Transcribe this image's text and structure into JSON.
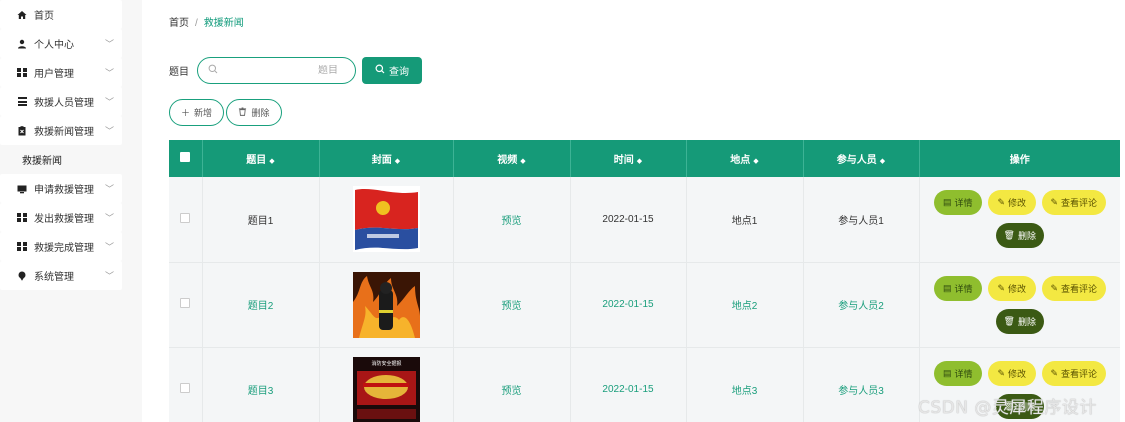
{
  "sidebar": {
    "items": [
      {
        "label": "首页",
        "icon": "home-icon",
        "has_arrow": false
      },
      {
        "label": "个人中心",
        "icon": "person-icon",
        "has_arrow": true
      },
      {
        "label": "用户管理",
        "icon": "grid-icon",
        "has_arrow": true
      },
      {
        "label": "救援人员管理",
        "icon": "list-icon",
        "has_arrow": true
      },
      {
        "label": "救援新闻管理",
        "icon": "clipboard-icon",
        "has_arrow": true
      }
    ],
    "active_sub": "救援新闻",
    "items_after": [
      {
        "label": "申请救援管理",
        "icon": "monitor-icon",
        "has_arrow": true
      },
      {
        "label": "发出救援管理",
        "icon": "grid-icon",
        "has_arrow": true
      },
      {
        "label": "救援完成管理",
        "icon": "grid-icon",
        "has_arrow": true
      },
      {
        "label": "系统管理",
        "icon": "pin-icon",
        "has_arrow": true
      }
    ]
  },
  "breadcrumb": {
    "home": "首页",
    "separator": "/",
    "current": "救援新闻"
  },
  "search": {
    "label": "题目",
    "placeholder": "题目",
    "query_label": "查询"
  },
  "actions": {
    "add_label": "新增",
    "delete_label": "删除"
  },
  "table": {
    "columns": [
      "题目",
      "封面",
      "视频",
      "时间",
      "地点",
      "参与人员",
      "操作"
    ],
    "rows": [
      {
        "title": "题目1",
        "cover": "flag-image",
        "video": "预览",
        "time": "2022-01-15",
        "place": "地点1",
        "people": "参与人员1"
      },
      {
        "title": "题目2",
        "cover": "firefighter-image",
        "video": "预览",
        "time": "2022-01-15",
        "place": "地点2",
        "people": "参与人员2"
      },
      {
        "title": "题目3",
        "cover": "poster-image",
        "video": "预览",
        "time": "2022-01-15",
        "place": "地点3",
        "people": "参与人员3"
      }
    ],
    "op_labels": {
      "detail": "详情",
      "edit": "修改",
      "comment": "查看评论",
      "delete": "删除"
    }
  },
  "poster_text": "消防安全据报",
  "watermark": "CSDN @灵犀程序设计",
  "colors": {
    "primary": "#159a78",
    "detail": "#8fbe2e",
    "edit": "#f3e842",
    "delete": "#3b5a14"
  }
}
